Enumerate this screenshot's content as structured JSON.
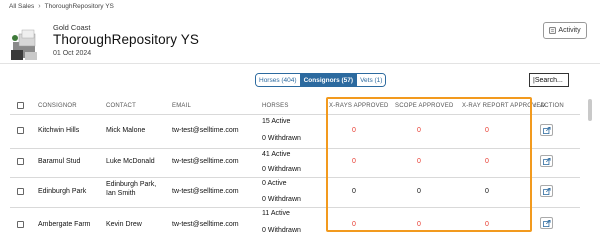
{
  "breadcrumb": {
    "parent": "All Sales",
    "current": "ThoroughRepository YS"
  },
  "sale": {
    "location": "Gold Coast",
    "title": "ThoroughRepository YS",
    "date": "01 Oct 2024"
  },
  "activity_button": {
    "label": "Activity",
    "icon": "activity-icon"
  },
  "tabs": [
    {
      "label": "Horses (404)",
      "active": false
    },
    {
      "label": "Consignors (57)",
      "active": true
    },
    {
      "label": "Vets (1)",
      "active": false
    }
  ],
  "search": {
    "value": "|Search..."
  },
  "table": {
    "headers": {
      "consignor": "CONSIGNOR",
      "contact": "CONTACT",
      "email": "EMAIL",
      "horses": "HORSES",
      "xray": "X-RAYS APPROVED",
      "scope": "SCOPE APPROVED",
      "xray_report": "X-RAY REPORT APPROVED",
      "action": "ACTION"
    },
    "rows": [
      {
        "consignor": "Kitchwin Hills",
        "contact": "Mick Malone",
        "email": "tw-test@selltime.com",
        "active": "15 Active",
        "withdrawn": "0 Withdrawn",
        "xray": "0",
        "scope": "0",
        "xray_report": "0",
        "zeros_red": true
      },
      {
        "consignor": "Baramul Stud",
        "contact": "Luke McDonald",
        "email": "tw-test@selltime.com",
        "active": "41 Active",
        "withdrawn": "0 Withdrawn",
        "xray": "0",
        "scope": "0",
        "xray_report": "0",
        "zeros_red": true
      },
      {
        "consignor": "Edinburgh Park",
        "contact": "Edinburgh Park, Ian Smith",
        "email": "tw-test@selltime.com",
        "active": "0 Active",
        "withdrawn": "0 Withdrawn",
        "xray": "0",
        "scope": "0",
        "xray_report": "0",
        "zeros_red": false
      },
      {
        "consignor": "Ambergate Farm",
        "contact": "Kevin Drew",
        "email": "tw-test@selltime.com",
        "active": "11 Active",
        "withdrawn": "0 Withdrawn",
        "xray": "0",
        "scope": "0",
        "xray_report": "0",
        "zeros_red": true
      }
    ]
  },
  "colors": {
    "accent": "#2c6a9f",
    "highlight": "#f29a1e",
    "zero_red": "#e83a2f"
  }
}
